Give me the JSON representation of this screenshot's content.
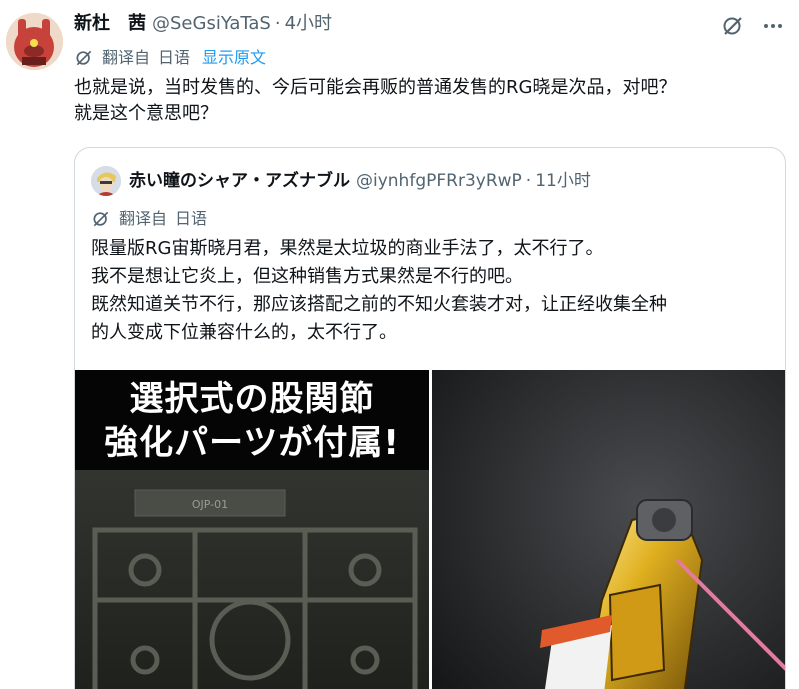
{
  "tweet": {
    "author_name": "新杜　茜",
    "author_handle": "@SeGsiYaTaS",
    "separator": "·",
    "time": "4小时",
    "translation": {
      "label": "翻译自",
      "language": "日语",
      "show_original": "显示原文"
    },
    "text_lines": [
      "也就是说，当时发售的、今后可能会再贩的普通发售的RG晓是次品，对吧？",
      "就是这个意思吧？"
    ]
  },
  "quote": {
    "author_name": "赤い瞳のシャア・アズナブル",
    "author_handle": "@iynhfgPFRr3yRwP",
    "separator": "·",
    "time": "11小时",
    "translation": {
      "label": "翻译自",
      "language": "日语"
    },
    "text_lines": [
      "限量版RG宙斯晓月君，果然是太垃圾的商业手法了，太不行了。",
      "我不是想让它炎上，但这种销售方式果然是不行的吧。",
      "既然知道关节不行，那应该搭配之前的不知火套装才对，让正经收集全种",
      "的人变成下位兼容什么的，太不行了。"
    ],
    "media": {
      "left_banner_lines": [
        "選択式の股関節",
        "強化パーツが付属!"
      ],
      "left_sprue_label": "OJP-01"
    }
  },
  "icons": {
    "grok": "grok-icon",
    "more": "more-icon",
    "translate": "translate-icon"
  },
  "colors": {
    "link": "#1d9bf0",
    "secondary_text": "#536471",
    "border": "#cfd9de"
  }
}
